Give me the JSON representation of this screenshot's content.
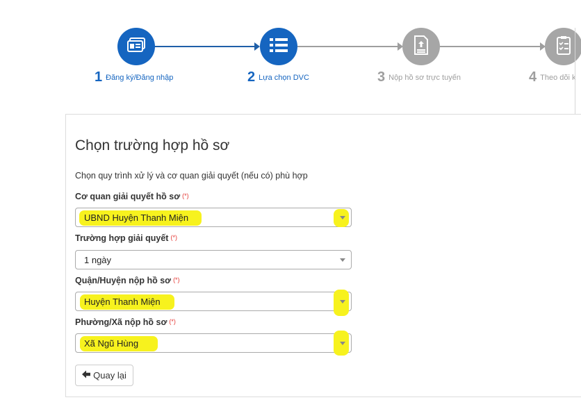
{
  "stepper": {
    "steps": [
      {
        "number": "1",
        "label": "Đăng ký/Đăng nhập",
        "state": "active",
        "icon": "id-card-icon"
      },
      {
        "number": "2",
        "label": "Lựa chọn DVC",
        "state": "active",
        "icon": "list-icon"
      },
      {
        "number": "3",
        "label": "Nộp hồ sơ trực tuyến",
        "state": "inactive",
        "icon": "upload-document-icon"
      },
      {
        "number": "4",
        "label": "Theo dõi k",
        "state": "inactive",
        "icon": "checklist-icon"
      }
    ]
  },
  "form": {
    "title": "Chọn trường hợp hồ sơ",
    "description": "Chọn quy trình xử lý và cơ quan giải quyết (nếu có) phù hợp",
    "required_mark": "(*)",
    "fields": {
      "agency": {
        "label": "Cơ quan giải quyết hồ sơ",
        "value": "UBND Huyện Thanh Miện"
      },
      "case": {
        "label": "Trường hợp giải quyết",
        "value": "1 ngày"
      },
      "district": {
        "label": "Quận/Huyện nộp hồ sơ",
        "value": "Huyện Thanh Miện"
      },
      "ward": {
        "label": "Phường/Xã nộp hồ sơ",
        "value": "Xã Ngũ Hùng"
      }
    },
    "back_button": "Quay lại"
  },
  "colors": {
    "active": "#1565c0",
    "inactive": "#a6a6a6",
    "highlight": "#f7f21e",
    "required": "#e53935"
  }
}
